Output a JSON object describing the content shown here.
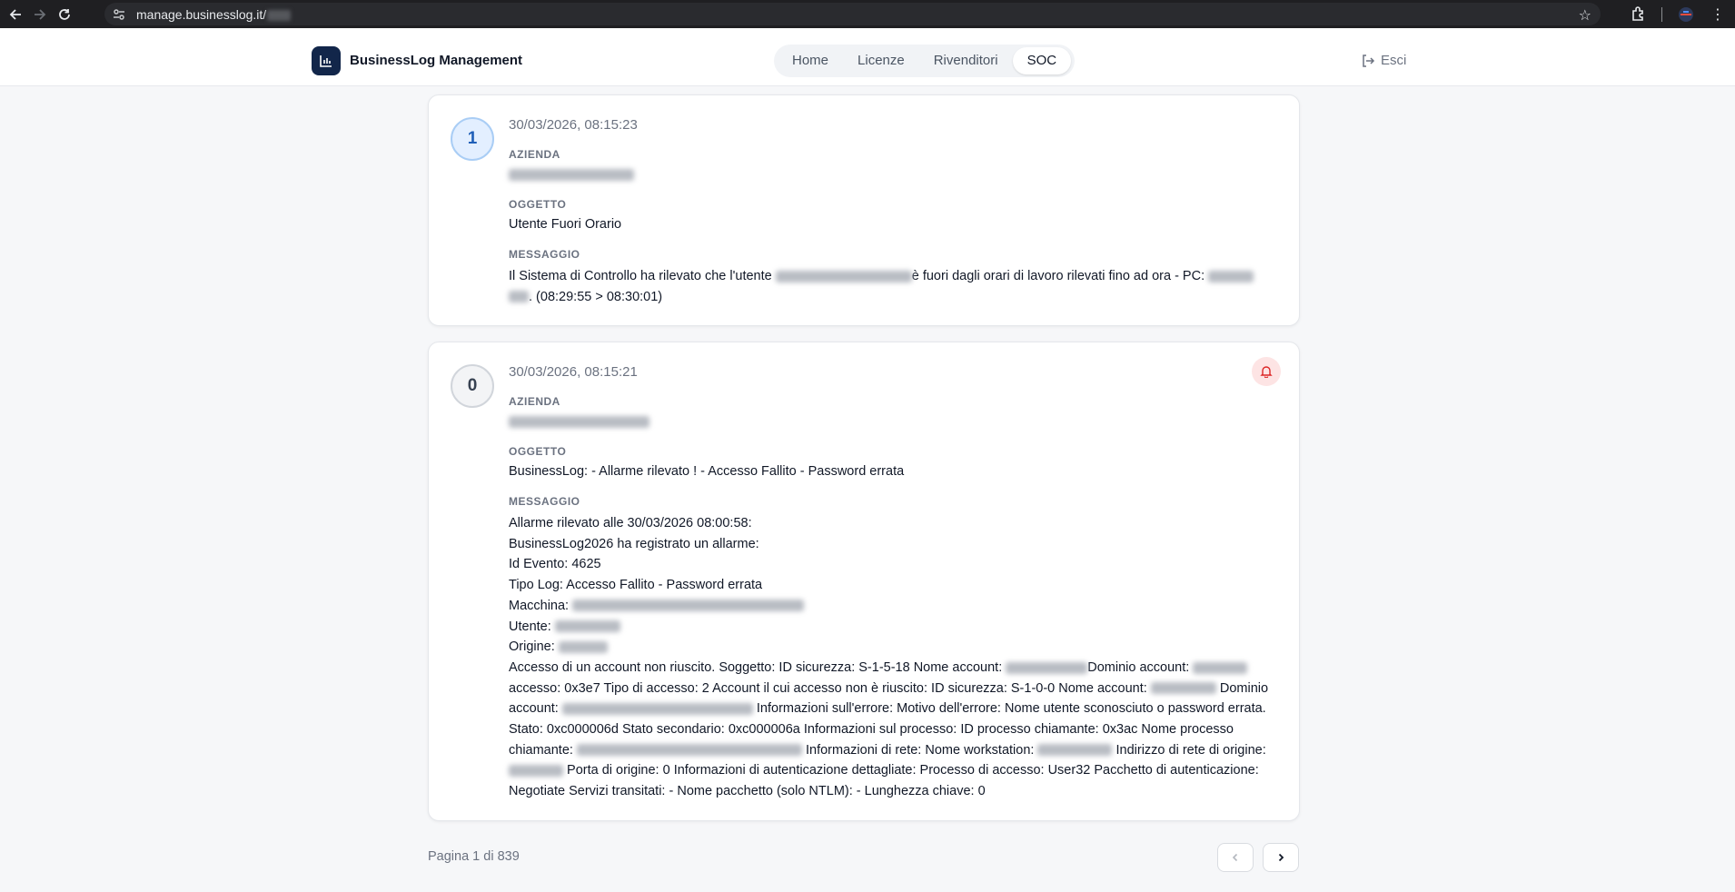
{
  "browser": {
    "url": "manage.businesslog.it/"
  },
  "header": {
    "brand": "BusinessLog Management",
    "tabs": [
      {
        "label": "Home",
        "active": false
      },
      {
        "label": "Licenze",
        "active": false
      },
      {
        "label": "Rivenditori",
        "active": false
      },
      {
        "label": "SOC",
        "active": true
      }
    ],
    "logout_label": "Esci"
  },
  "labels": {
    "azienda": "AZIENDA",
    "oggetto": "OGGETTO",
    "messaggio": "MESSAGGIO"
  },
  "alerts": [
    {
      "badge": "1",
      "timestamp": "30/03/2026, 08:15:23",
      "oggetto": "Utente Fuori Orario",
      "message_parts": {
        "p1": "Il Sistema di Controllo ha rilevato che l'utente",
        "p2": "è fuori dagli orari di lavoro rilevati fino ad ora - PC:",
        "p3": ". (08:29:55 > 08:30:01)"
      }
    },
    {
      "badge": "0",
      "timestamp": "30/03/2026, 08:15:21",
      "oggetto": "BusinessLog: - Allarme rilevato ! - Accesso Fallito - Password errata",
      "lines": {
        "l1": "Allarme rilevato alle 30/03/2026 08:00:58:",
        "l2": "BusinessLog2026 ha registrato un allarme:",
        "l3": "Id Evento: 4625",
        "l4": "Tipo Log: Accesso Fallito - Password errata",
        "l5": "Macchina:",
        "l6": "Utente:",
        "l7": "Origine:"
      },
      "detail": {
        "d1": "Accesso di un account non riuscito. Soggetto: ID sicurezza: S-1-5-18 Nome account:",
        "d2": "Dominio account:",
        "d3": "accesso: 0x3e7 Tipo di accesso: 2 Account il cui accesso non è riuscito: ID sicurezza: S-1-0-0 Nome account:",
        "d4": "Dominio account:",
        "d5": "Informazioni sull'errore: Motivo dell'errore: Nome utente sconosciuto o password errata. Stato: 0xc000006d Stato secondario: 0xc000006a Informazioni sul processo: ID processo chiamante: 0x3ac Nome processo chiamante:",
        "d6": "Informazioni di rete: Nome workstation:",
        "d7": "Indirizzo di rete di origine:",
        "d8": "Porta di origine: 0 Informazioni di autenticazione dettagliate: Processo di accesso: User32 Pacchetto di autenticazione: Negotiate Servizi transitati: - Nome pacchetto (solo NTLM): - Lunghezza chiave: 0"
      }
    }
  ],
  "pagination": {
    "text": "Pagina 1 di 839"
  },
  "colors": {
    "brand": "#12264a",
    "badge_blue_bg": "#e3efff",
    "badge_blue_border": "#a9cdf5",
    "alarm_bg": "#fde4e4",
    "alarm_icon": "#dc2626"
  }
}
